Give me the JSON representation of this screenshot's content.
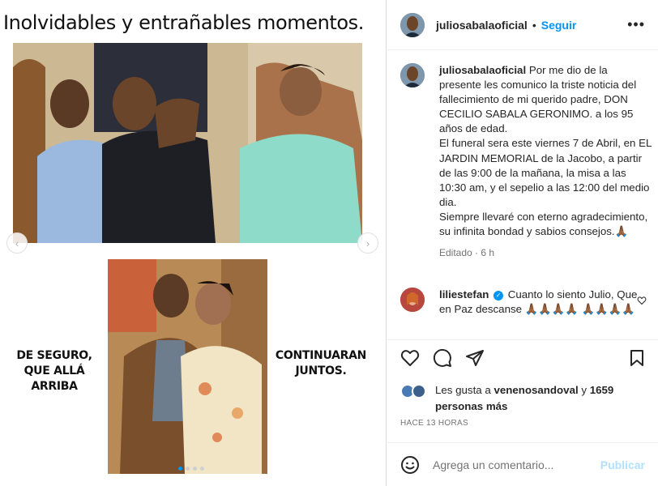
{
  "post_media": {
    "title": "Inolvidables y entrañables momentos.",
    "left_text": "DE SEGURO,\nQUE ALLÁ ARRIBA",
    "right_text": "CONTINUARAN\nJUNTOS.",
    "carousel": {
      "slides": 4,
      "active_index": 0
    }
  },
  "header": {
    "username": "juliosabalaoficial",
    "separator": "•",
    "follow_label": "Seguir",
    "more_icon": "more-horizontal-icon"
  },
  "caption": {
    "username": "juliosabalaoficial",
    "text": "Por me dio de la presente les comunico la triste noticia del fallecimiento de mi querido padre, DON CECILIO SABALA GERONIMO. a los 95 años de edad.\nEl funeral sera este viernes 7 de Abril, en EL JARDIN MEMORIAL de la Jacobo, a partir de las 9:00 de la mañana, la misa a las 10:30 am, y el sepelio a las 12:00 del medio dia.\nSiempre llevaré con eterno agradecimiento, su infinita bondad y sabios consejos.🙏🏾",
    "edited": "Editado · 6 h"
  },
  "comment": {
    "username": "liliestefan",
    "verified": true,
    "text": "Cuanto lo siento Julio, Que en Paz descanse 🙏🏾🙏🏾🙏🏾🙏🏾 🙏🏾🙏🏾🙏🏾🙏🏾"
  },
  "actions": {
    "like_icon": "heart-icon",
    "comment_icon": "comment-icon",
    "share_icon": "share-icon",
    "save_icon": "bookmark-icon"
  },
  "likes": {
    "prefix": "Les gusta a",
    "user": "venenosandoval",
    "middle": "y",
    "count": "1659 personas más"
  },
  "timestamp": "HACE 13 HORAS",
  "add_comment": {
    "placeholder": "Agrega un comentario...",
    "publish_label": "Publicar"
  }
}
